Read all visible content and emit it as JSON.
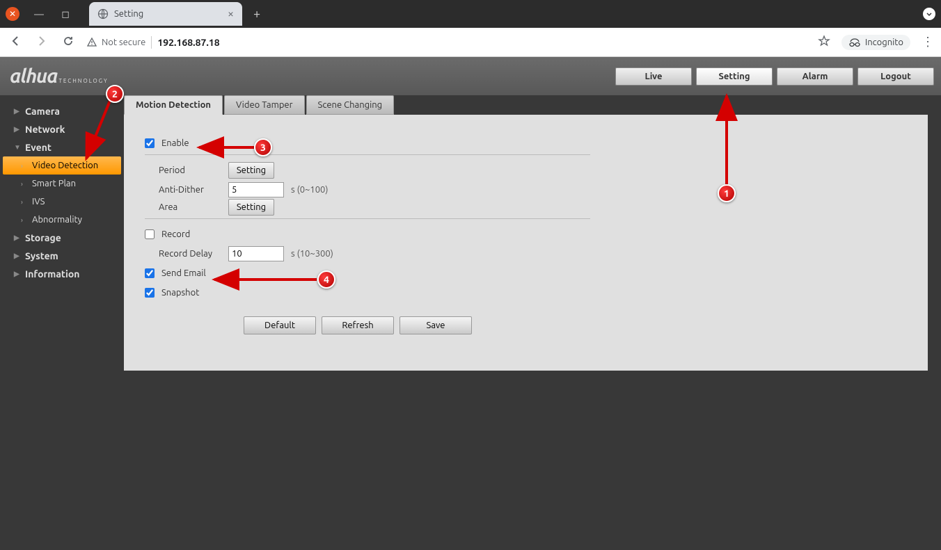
{
  "window": {
    "tab_title": "Setting"
  },
  "addressbar": {
    "not_secure": "Not secure",
    "url": "192.168.87.18",
    "incognito": "Incognito"
  },
  "logo": {
    "main": "alhua",
    "sub": "TECHNOLOGY"
  },
  "topnav": {
    "live": "Live",
    "setting": "Setting",
    "alarm": "Alarm",
    "logout": "Logout"
  },
  "sidebar": {
    "camera": "Camera",
    "network": "Network",
    "event": "Event",
    "event_items": {
      "video_detection": "Video Detection",
      "smart_plan": "Smart Plan",
      "ivs": "IVS",
      "abnormality": "Abnormality"
    },
    "storage": "Storage",
    "system": "System",
    "information": "Information"
  },
  "tabs": {
    "motion": "Motion Detection",
    "tamper": "Video Tamper",
    "scene": "Scene Changing"
  },
  "form": {
    "enable": "Enable",
    "period": "Period",
    "period_btn": "Setting",
    "anti_dither": "Anti-Dither",
    "anti_dither_val": "5",
    "anti_dither_hint": "s (0~100)",
    "area": "Area",
    "area_btn": "Setting",
    "record": "Record",
    "record_delay": "Record Delay",
    "record_delay_val": "10",
    "record_delay_hint": "s (10~300)",
    "send_email": "Send Email",
    "snapshot": "Snapshot",
    "default": "Default",
    "refresh": "Refresh",
    "save": "Save"
  },
  "annotations": {
    "a1": "1",
    "a2": "2",
    "a3": "3",
    "a4": "4"
  }
}
